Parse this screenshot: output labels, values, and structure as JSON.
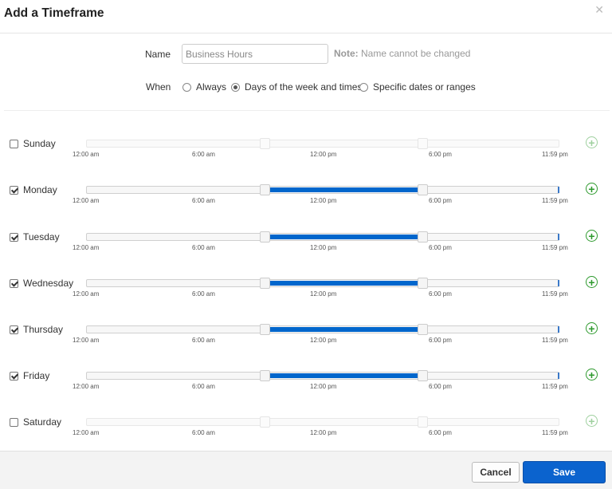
{
  "dialog": {
    "title": "Add a Timeframe",
    "close_icon": "close-icon"
  },
  "form": {
    "name_label": "Name",
    "name_value": "Business Hours",
    "note_bold": "Note:",
    "note_text": "Name cannot be changed",
    "when_label": "When",
    "options": [
      {
        "label": "Always",
        "selected": false
      },
      {
        "label": "Days of the week and times",
        "selected": true
      },
      {
        "label": "Specific dates or ranges",
        "selected": false
      }
    ]
  },
  "ticks": [
    "12:00 am",
    "6:00 am",
    "12:00 pm",
    "6:00 pm",
    "11:59 pm"
  ],
  "days": [
    {
      "name": "Sunday",
      "checked": false,
      "start_fraction": 0.375,
      "end_fraction": 0.708
    },
    {
      "name": "Monday",
      "checked": true,
      "start_fraction": 0.375,
      "end_fraction": 0.708
    },
    {
      "name": "Tuesday",
      "checked": true,
      "start_fraction": 0.375,
      "end_fraction": 0.708
    },
    {
      "name": "Wednesday",
      "checked": true,
      "start_fraction": 0.375,
      "end_fraction": 0.708
    },
    {
      "name": "Thursday",
      "checked": true,
      "start_fraction": 0.375,
      "end_fraction": 0.708
    },
    {
      "name": "Friday",
      "checked": true,
      "start_fraction": 0.375,
      "end_fraction": 0.708
    },
    {
      "name": "Saturday",
      "checked": false,
      "start_fraction": 0.375,
      "end_fraction": 0.708
    }
  ],
  "footer": {
    "cancel_label": "Cancel",
    "save_label": "Save"
  },
  "colors": {
    "accent": "#0b63ce",
    "range": "#0066cc",
    "add": "#2e9a2e"
  }
}
